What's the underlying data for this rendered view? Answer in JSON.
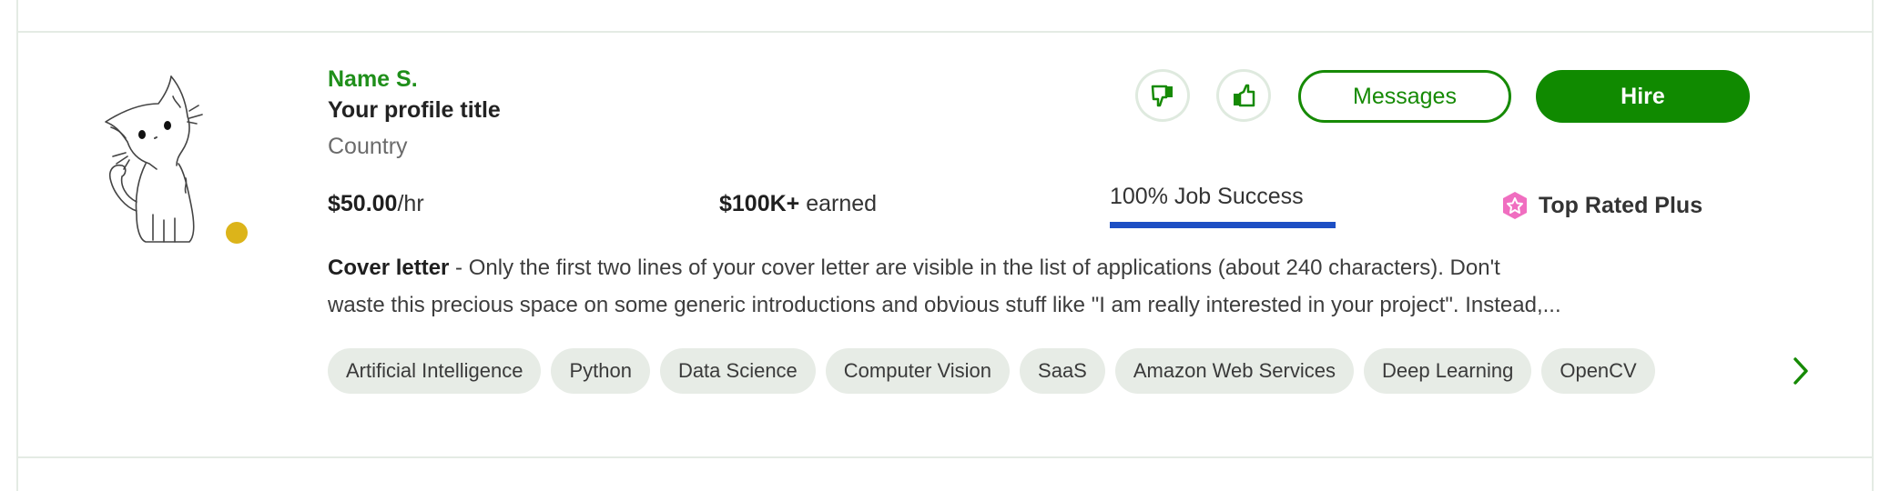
{
  "freelancer": {
    "name": "Name S.",
    "title": "Your profile title",
    "country": "Country",
    "online_status_color": "#dcb41a",
    "avatar": "cat-line-drawing"
  },
  "actions": {
    "thumbs_down_icon": "thumbs-down-icon",
    "thumbs_up_icon": "thumbs-up-icon",
    "messages_label": "Messages",
    "hire_label": "Hire"
  },
  "stats": {
    "rate_amount": "$50.00",
    "rate_unit": "/hr",
    "earned_amount": "$100K+",
    "earned_label": " earned",
    "job_success_label": "100% Job Success",
    "job_success_percent": 100,
    "badge_label": "Top Rated Plus",
    "badge_icon": "top-rated-plus-icon"
  },
  "cover_letter": {
    "label": "Cover letter",
    "separator": " - ",
    "line1": "Only the first two lines of your cover letter are visible in the list of applications (about 240 characters). Don't",
    "line2": "waste this precious space on some generic introductions and obvious stuff like \"I am really interested in your project\". Instead,..."
  },
  "skills": [
    "Artificial Intelligence",
    "Python",
    "Data Science",
    "Computer Vision",
    "SaaS",
    "Amazon Web Services",
    "Deep Learning",
    "OpenCV"
  ],
  "skills_next_icon": "chevron-right-icon",
  "colors": {
    "brand_green": "#108a00",
    "job_success_bar": "#1d4fc4",
    "badge_pink": "#f06ec0",
    "chip_bg": "#e7ece6"
  }
}
